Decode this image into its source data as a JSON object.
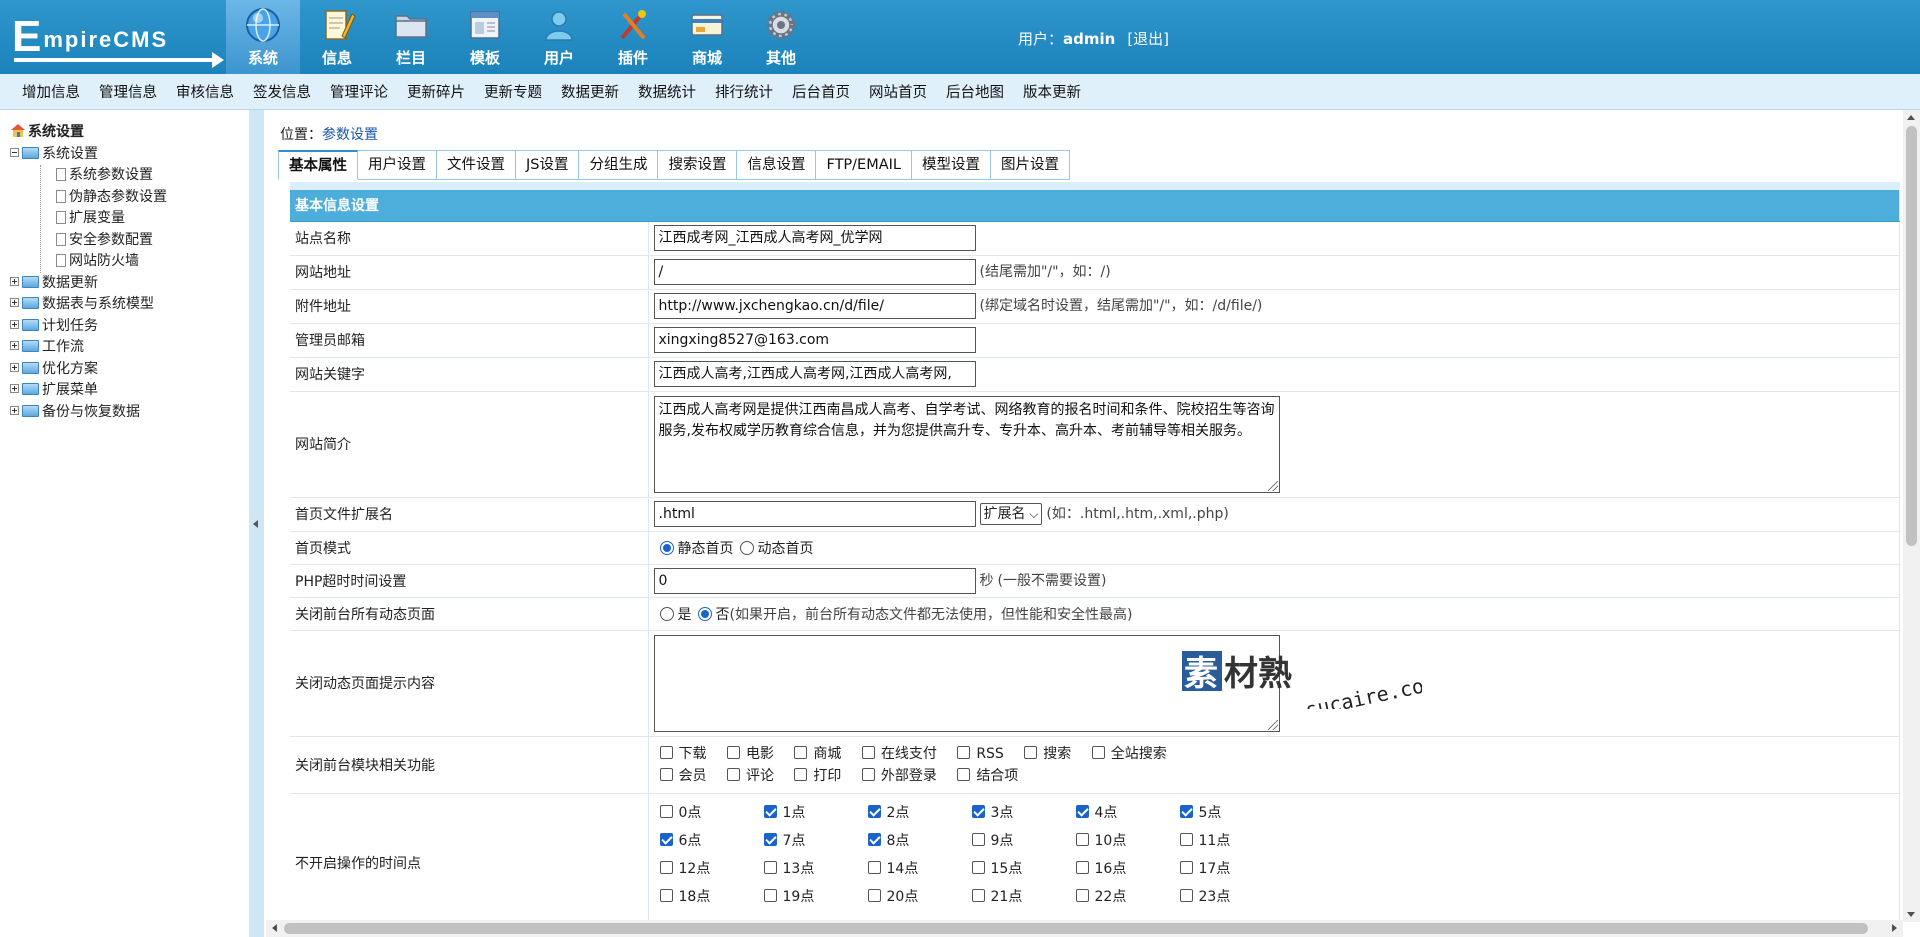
{
  "app": {
    "logo_text_e": "E",
    "logo_text_rest": "mpireCMS"
  },
  "topnav": [
    {
      "label": "系统",
      "icon": "globe-icon",
      "active": true
    },
    {
      "label": "信息",
      "icon": "notepad-icon"
    },
    {
      "label": "栏目",
      "icon": "folder-icon"
    },
    {
      "label": "模板",
      "icon": "window-icon"
    },
    {
      "label": "用户",
      "icon": "user-icon"
    },
    {
      "label": "插件",
      "icon": "tools-icon"
    },
    {
      "label": "商城",
      "icon": "card-icon"
    },
    {
      "label": "其他",
      "icon": "gear-icon"
    }
  ],
  "user": {
    "prefix": "用户：",
    "name": "admin",
    "logout": "[退出]"
  },
  "subnav": [
    "增加信息",
    "管理信息",
    "审核信息",
    "签发信息",
    "管理评论",
    "更新碎片",
    "更新专题",
    "数据更新",
    "数据统计",
    "排行统计",
    "后台首页",
    "网站首页",
    "后台地图",
    "版本更新"
  ],
  "sidebar": {
    "root": "系统设置",
    "group1": "系统设置",
    "children": [
      "系统参数设置",
      "伪静态参数设置",
      "扩展变量",
      "安全参数配置",
      "网站防火墙"
    ],
    "groups": [
      "数据更新",
      "数据表与系统模型",
      "计划任务",
      "工作流",
      "优化方案",
      "扩展菜单",
      "备份与恢复数据"
    ]
  },
  "crumb": {
    "label": "位置：",
    "link": "参数设置"
  },
  "tabs": [
    "基本属性",
    "用户设置",
    "文件设置",
    "JS设置",
    "分组生成",
    "搜索设置",
    "信息设置",
    "FTP/EMAIL",
    "模型设置",
    "图片设置"
  ],
  "form": {
    "section": "基本信息设置",
    "site_name_label": "站点名称",
    "site_name": "江西成考网_江西成人高考网_优学网",
    "site_url_label": "网站地址",
    "site_url": "/",
    "site_url_hint": "(结尾需加\"/\"，如：/)",
    "attach_label": "附件地址",
    "attach_url": "http://www.jxchengkao.cn/d/file/",
    "attach_hint": "(绑定域名时设置，结尾需加\"/\"，如：/d/file/)",
    "email_label": "管理员邮箱",
    "email": "xingxing8527@163.com",
    "keywords_label": "网站关键字",
    "keywords": "江西成人高考,江西成人高考网,江西成人高考网,",
    "intro_label": "网站简介",
    "intro": "江西成人高考网是提供江西南昌成人高考、自学考试、网络教育的报名时间和条件、院校招生等咨询服务,发布权威学历教育综合信息，并为您提供高升专、专升本、高升本、考前辅导等相关服务。",
    "ext_label": "首页文件扩展名",
    "ext": ".html",
    "ext_select": "扩展名",
    "ext_hint": "(如：.html,.htm,.xml,.php)",
    "mode_label": "首页模式",
    "mode_static": "静态首页",
    "mode_dynamic": "动态首页",
    "timeout_label": "PHP超时时间设置",
    "timeout": "0",
    "timeout_unit": "秒",
    "timeout_hint": "(一般不需要设置)",
    "close_dyn_label": "关闭前台所有动态页面",
    "yes": "是",
    "no": "否",
    "close_dyn_hint": "(如果开启，前台所有动态文件都无法使用，但性能和安全性最高)",
    "close_msg_label": "关闭动态页面提示内容",
    "close_modules_label": "关闭前台模块相关功能",
    "modules_row1": [
      "下载",
      "电影",
      "商城",
      "在线支付",
      "RSS",
      "搜索",
      "全站搜索"
    ],
    "modules_row2": [
      "会员",
      "评论",
      "打印",
      "外部登录",
      "结合项"
    ],
    "hours_label": "不开启操作的时间点",
    "hours": [
      {
        "label": "0点",
        "checked": false
      },
      {
        "label": "1点",
        "checked": true
      },
      {
        "label": "2点",
        "checked": true
      },
      {
        "label": "3点",
        "checked": true
      },
      {
        "label": "4点",
        "checked": true
      },
      {
        "label": "5点",
        "checked": true
      },
      {
        "label": "6点",
        "checked": true
      },
      {
        "label": "7点",
        "checked": true
      },
      {
        "label": "8点",
        "checked": true
      },
      {
        "label": "9点",
        "checked": false
      },
      {
        "label": "10点",
        "checked": false
      },
      {
        "label": "11点",
        "checked": false
      },
      {
        "label": "12点",
        "checked": false
      },
      {
        "label": "13点",
        "checked": false
      },
      {
        "label": "14点",
        "checked": false
      },
      {
        "label": "15点",
        "checked": false
      },
      {
        "label": "16点",
        "checked": false
      },
      {
        "label": "17点",
        "checked": false
      },
      {
        "label": "18点",
        "checked": false
      },
      {
        "label": "19点",
        "checked": false
      },
      {
        "label": "20点",
        "checked": false
      },
      {
        "label": "21点",
        "checked": false
      },
      {
        "label": "22点",
        "checked": false
      },
      {
        "label": "23点",
        "checked": false
      }
    ]
  },
  "watermark": {
    "cn": "素材熟",
    "en": "sucaire.com"
  },
  "colors": {
    "topbar": "#2f97cc",
    "subnav": "#dff0fb",
    "section_head": "#4daedb",
    "accent": "#1a63c9"
  }
}
